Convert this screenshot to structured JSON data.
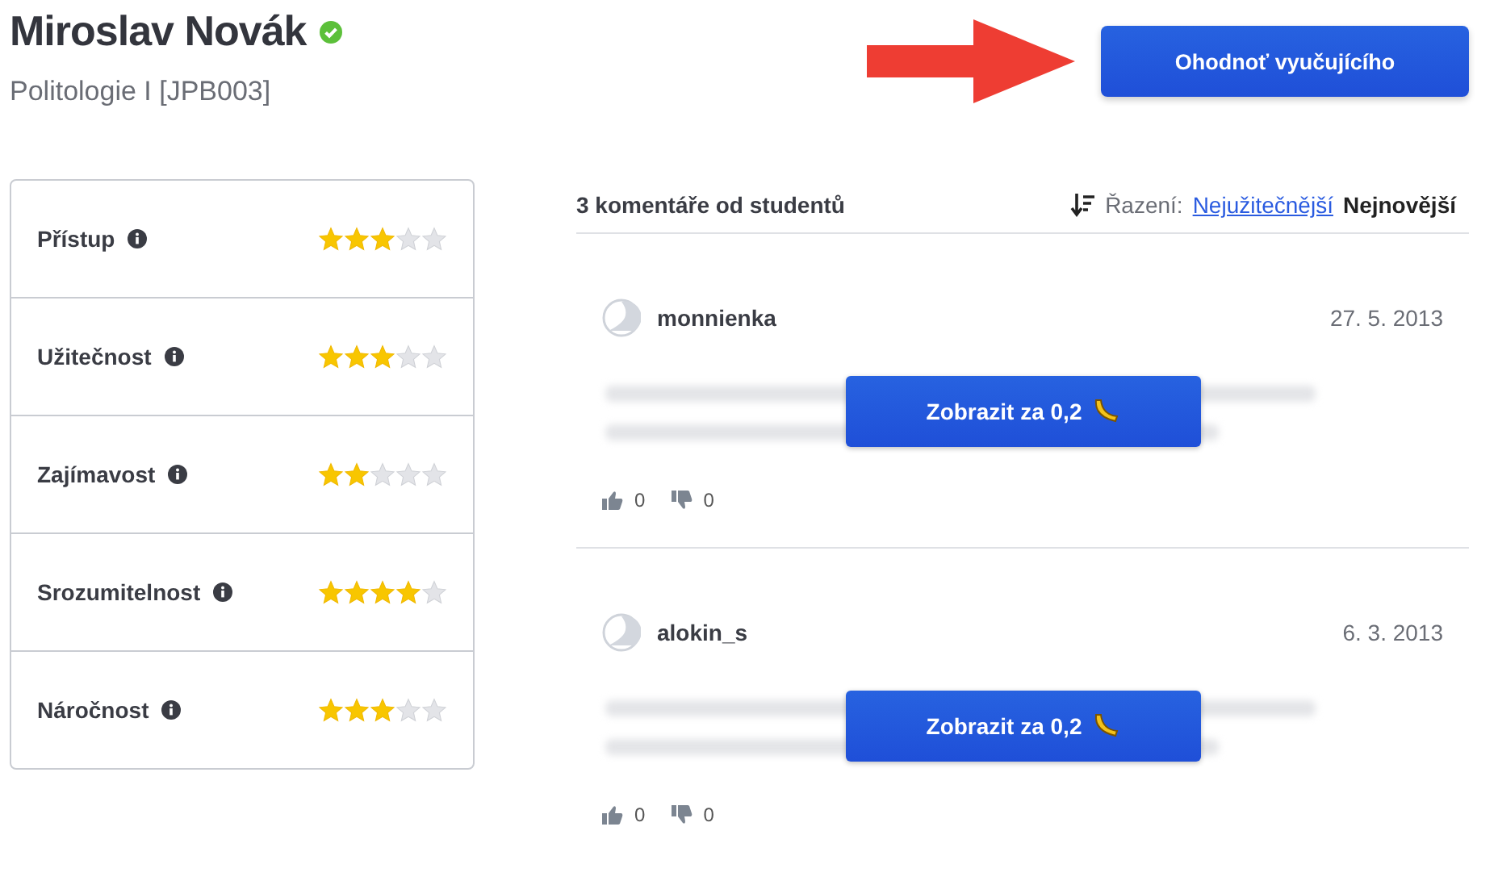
{
  "teacher": {
    "name": "Miroslav Novák",
    "verified": true,
    "course": "Politologie I [JPB003]"
  },
  "rate_button": "Ohodnoť vyučujícího",
  "ratings": [
    {
      "label": "Přístup",
      "stars": 3
    },
    {
      "label": "Užitečnost",
      "stars": 3
    },
    {
      "label": "Zajímavost",
      "stars": 2
    },
    {
      "label": "Srozumitelnost",
      "stars": 4
    },
    {
      "label": "Náročnost",
      "stars": 3
    }
  ],
  "comments_header": {
    "count": "3 komentáře od studentů",
    "sort_label": "Řazení:",
    "sort_options": [
      {
        "label": "Nejužitečnější",
        "selected": false
      },
      {
        "label": "Nejnovější",
        "selected": true
      }
    ]
  },
  "comments": [
    {
      "author": "monnienka",
      "date": "27. 5. 2013",
      "unlock": "Zobrazit za 0,2",
      "likes": "0",
      "dislikes": "0"
    },
    {
      "author": "alokin_s",
      "date": "6. 3. 2013",
      "unlock": "Zobrazit za 0,2",
      "likes": "0",
      "dislikes": "0"
    }
  ]
}
